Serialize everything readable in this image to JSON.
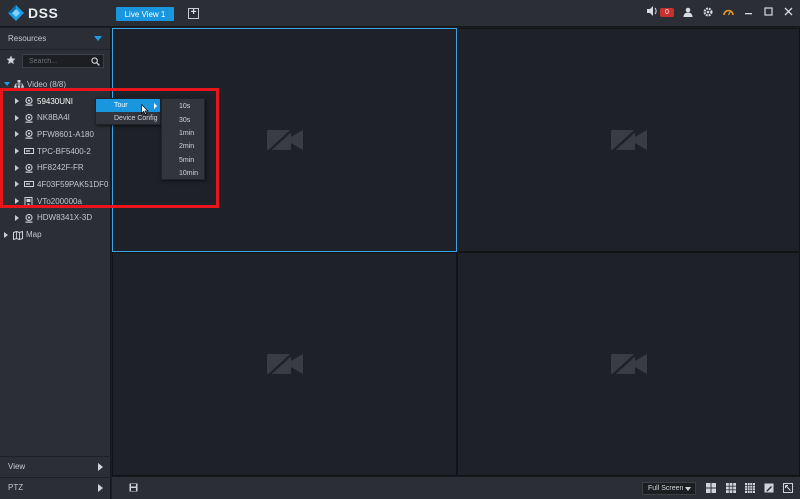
{
  "app": {
    "logo_text": "DSS"
  },
  "tabs": [
    {
      "label": "Live View 1"
    }
  ],
  "add_tab_glyph": "+",
  "alarm": {
    "count": "0"
  },
  "sidebar": {
    "resources_label": "Resources",
    "search_placeholder": "Search...",
    "tree": {
      "video_label": "Video (8/8)",
      "devices": [
        {
          "label": "59430UNI",
          "icon": "camera-icon"
        },
        {
          "label": "NK8BA4I",
          "icon": "camera-icon"
        },
        {
          "label": "PFW8601-A180",
          "icon": "camera-icon"
        },
        {
          "label": "TPC-BF5400-2",
          "icon": "nvr-icon"
        },
        {
          "label": "HF8242F-FR",
          "icon": "camera-icon"
        },
        {
          "label": "4F03F59PAK51DF0",
          "icon": "nvr-icon"
        },
        {
          "label": "VTo200000a",
          "icon": "intercom-icon"
        },
        {
          "label": "HDW8341X-3D",
          "icon": "camera-icon"
        }
      ],
      "map_label": "Map"
    },
    "view_label": "View",
    "ptz_label": "PTZ"
  },
  "context_menu": {
    "items": [
      {
        "label": "Tour"
      },
      {
        "label": "Device Config"
      }
    ],
    "tour_options": [
      "10s",
      "30s",
      "1min",
      "2min",
      "5min",
      "10min"
    ]
  },
  "bottombar": {
    "window_mode": "Full Screen"
  },
  "colors": {
    "accent": "#1a96de",
    "alarm": "#c8312d",
    "annotation": "#e8161b"
  }
}
